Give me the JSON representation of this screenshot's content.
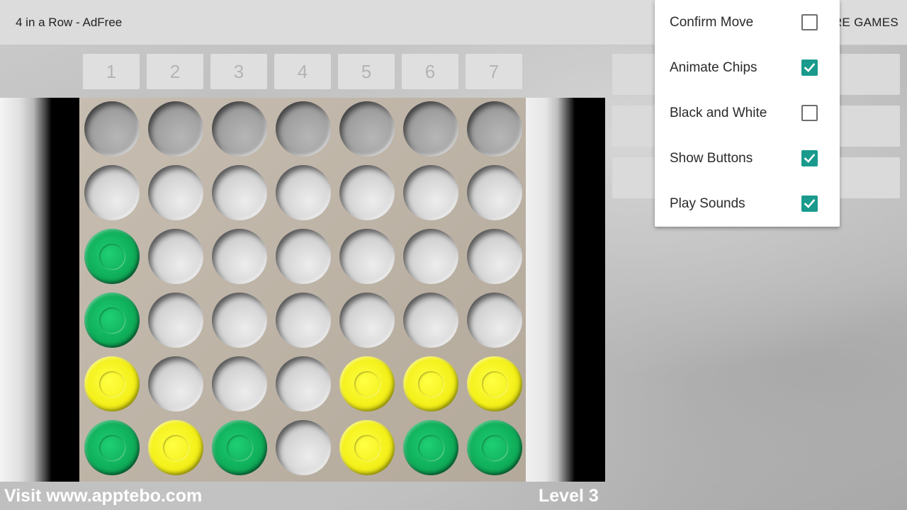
{
  "appbar": {
    "title": "4 in a Row - AdFree",
    "more_games": "RE GAMES"
  },
  "column_buttons": [
    "1",
    "2",
    "3",
    "4",
    "5",
    "6",
    "7"
  ],
  "board": {
    "rows": 6,
    "cols": 7,
    "cells": [
      [
        "empty",
        "empty",
        "empty",
        "empty",
        "empty",
        "empty",
        "empty"
      ],
      [
        "empty",
        "empty",
        "empty",
        "empty",
        "empty",
        "empty",
        "empty"
      ],
      [
        "green",
        "empty",
        "empty",
        "empty",
        "empty",
        "empty",
        "empty"
      ],
      [
        "green",
        "empty",
        "empty",
        "empty",
        "empty",
        "empty",
        "empty"
      ],
      [
        "yellow",
        "empty",
        "empty",
        "empty",
        "yellow",
        "yellow",
        "yellow"
      ],
      [
        "green",
        "yellow",
        "green",
        "empty",
        "yellow",
        "green",
        "green"
      ]
    ]
  },
  "side_buttons": {
    "third_button_icon": "more-vert-icon"
  },
  "footer": {
    "visit": "Visit www.apptebo.com",
    "level": "Level 3"
  },
  "menu": {
    "items": [
      {
        "label": "Confirm Move",
        "checked": false
      },
      {
        "label": "Animate Chips",
        "checked": true
      },
      {
        "label": "Black and White",
        "checked": false
      },
      {
        "label": "Show Buttons",
        "checked": true
      },
      {
        "label": "Play Sounds",
        "checked": true
      }
    ]
  },
  "colors": {
    "green_chip": "#0fae5a",
    "yellow_chip": "#f4f01a",
    "checkbox_accent": "#1a9a8c"
  }
}
